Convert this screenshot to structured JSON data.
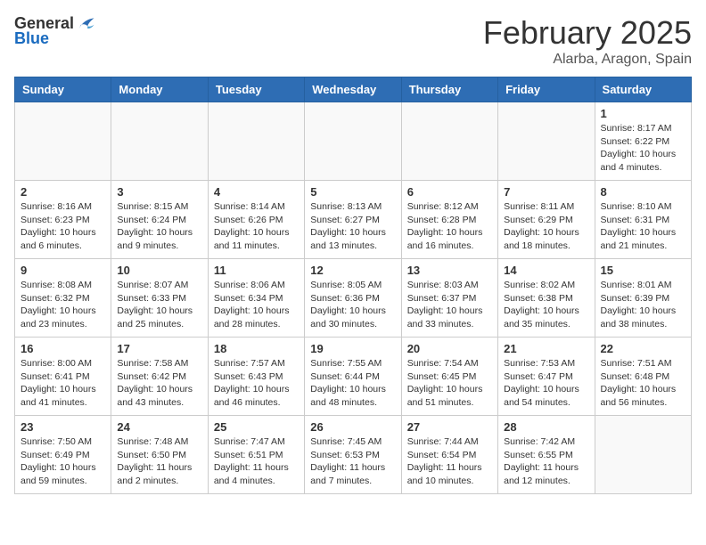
{
  "header": {
    "logo_general": "General",
    "logo_blue": "Blue",
    "month_title": "February 2025",
    "location": "Alarba, Aragon, Spain"
  },
  "days_of_week": [
    "Sunday",
    "Monday",
    "Tuesday",
    "Wednesday",
    "Thursday",
    "Friday",
    "Saturday"
  ],
  "weeks": [
    [
      {
        "day": "",
        "info": ""
      },
      {
        "day": "",
        "info": ""
      },
      {
        "day": "",
        "info": ""
      },
      {
        "day": "",
        "info": ""
      },
      {
        "day": "",
        "info": ""
      },
      {
        "day": "",
        "info": ""
      },
      {
        "day": "1",
        "info": "Sunrise: 8:17 AM\nSunset: 6:22 PM\nDaylight: 10 hours and 4 minutes."
      }
    ],
    [
      {
        "day": "2",
        "info": "Sunrise: 8:16 AM\nSunset: 6:23 PM\nDaylight: 10 hours and 6 minutes."
      },
      {
        "day": "3",
        "info": "Sunrise: 8:15 AM\nSunset: 6:24 PM\nDaylight: 10 hours and 9 minutes."
      },
      {
        "day": "4",
        "info": "Sunrise: 8:14 AM\nSunset: 6:26 PM\nDaylight: 10 hours and 11 minutes."
      },
      {
        "day": "5",
        "info": "Sunrise: 8:13 AM\nSunset: 6:27 PM\nDaylight: 10 hours and 13 minutes."
      },
      {
        "day": "6",
        "info": "Sunrise: 8:12 AM\nSunset: 6:28 PM\nDaylight: 10 hours and 16 minutes."
      },
      {
        "day": "7",
        "info": "Sunrise: 8:11 AM\nSunset: 6:29 PM\nDaylight: 10 hours and 18 minutes."
      },
      {
        "day": "8",
        "info": "Sunrise: 8:10 AM\nSunset: 6:31 PM\nDaylight: 10 hours and 21 minutes."
      }
    ],
    [
      {
        "day": "9",
        "info": "Sunrise: 8:08 AM\nSunset: 6:32 PM\nDaylight: 10 hours and 23 minutes."
      },
      {
        "day": "10",
        "info": "Sunrise: 8:07 AM\nSunset: 6:33 PM\nDaylight: 10 hours and 25 minutes."
      },
      {
        "day": "11",
        "info": "Sunrise: 8:06 AM\nSunset: 6:34 PM\nDaylight: 10 hours and 28 minutes."
      },
      {
        "day": "12",
        "info": "Sunrise: 8:05 AM\nSunset: 6:36 PM\nDaylight: 10 hours and 30 minutes."
      },
      {
        "day": "13",
        "info": "Sunrise: 8:03 AM\nSunset: 6:37 PM\nDaylight: 10 hours and 33 minutes."
      },
      {
        "day": "14",
        "info": "Sunrise: 8:02 AM\nSunset: 6:38 PM\nDaylight: 10 hours and 35 minutes."
      },
      {
        "day": "15",
        "info": "Sunrise: 8:01 AM\nSunset: 6:39 PM\nDaylight: 10 hours and 38 minutes."
      }
    ],
    [
      {
        "day": "16",
        "info": "Sunrise: 8:00 AM\nSunset: 6:41 PM\nDaylight: 10 hours and 41 minutes."
      },
      {
        "day": "17",
        "info": "Sunrise: 7:58 AM\nSunset: 6:42 PM\nDaylight: 10 hours and 43 minutes."
      },
      {
        "day": "18",
        "info": "Sunrise: 7:57 AM\nSunset: 6:43 PM\nDaylight: 10 hours and 46 minutes."
      },
      {
        "day": "19",
        "info": "Sunrise: 7:55 AM\nSunset: 6:44 PM\nDaylight: 10 hours and 48 minutes."
      },
      {
        "day": "20",
        "info": "Sunrise: 7:54 AM\nSunset: 6:45 PM\nDaylight: 10 hours and 51 minutes."
      },
      {
        "day": "21",
        "info": "Sunrise: 7:53 AM\nSunset: 6:47 PM\nDaylight: 10 hours and 54 minutes."
      },
      {
        "day": "22",
        "info": "Sunrise: 7:51 AM\nSunset: 6:48 PM\nDaylight: 10 hours and 56 minutes."
      }
    ],
    [
      {
        "day": "23",
        "info": "Sunrise: 7:50 AM\nSunset: 6:49 PM\nDaylight: 10 hours and 59 minutes."
      },
      {
        "day": "24",
        "info": "Sunrise: 7:48 AM\nSunset: 6:50 PM\nDaylight: 11 hours and 2 minutes."
      },
      {
        "day": "25",
        "info": "Sunrise: 7:47 AM\nSunset: 6:51 PM\nDaylight: 11 hours and 4 minutes."
      },
      {
        "day": "26",
        "info": "Sunrise: 7:45 AM\nSunset: 6:53 PM\nDaylight: 11 hours and 7 minutes."
      },
      {
        "day": "27",
        "info": "Sunrise: 7:44 AM\nSunset: 6:54 PM\nDaylight: 11 hours and 10 minutes."
      },
      {
        "day": "28",
        "info": "Sunrise: 7:42 AM\nSunset: 6:55 PM\nDaylight: 11 hours and 12 minutes."
      },
      {
        "day": "",
        "info": ""
      }
    ]
  ]
}
